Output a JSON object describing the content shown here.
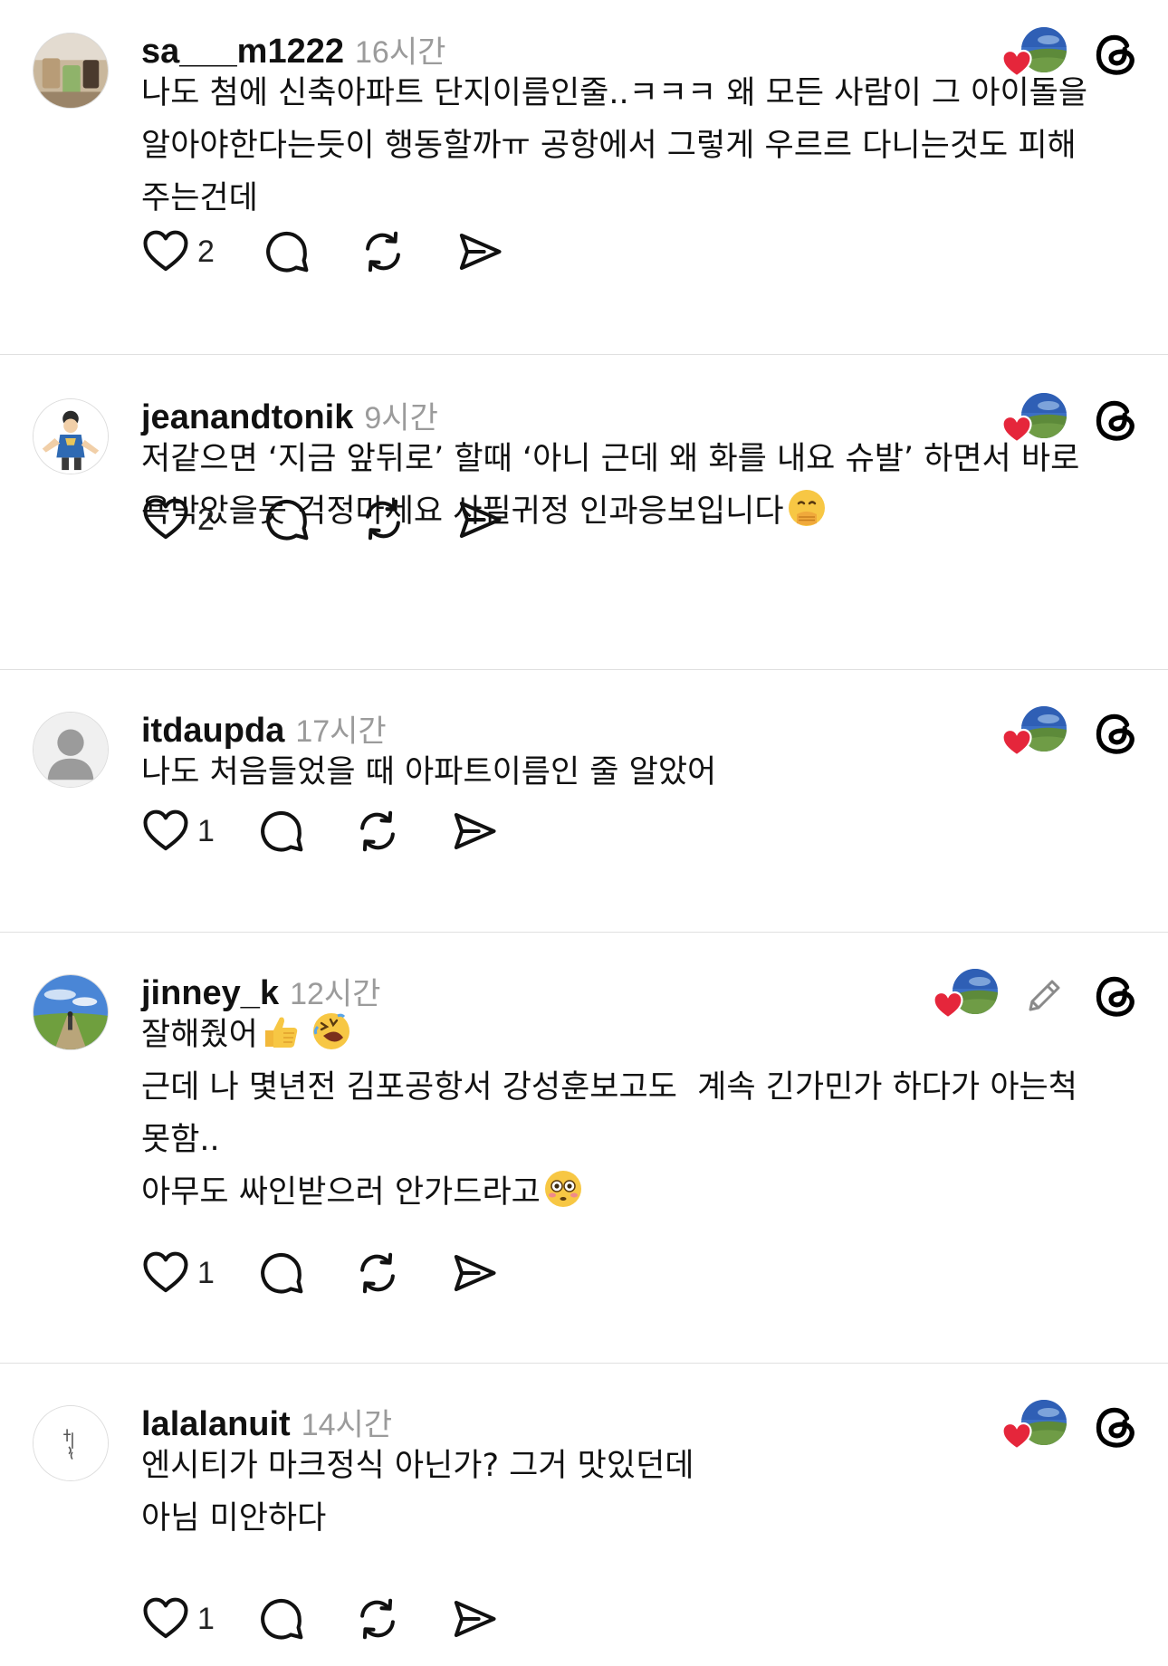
{
  "colors": {
    "like_heart": "#e5263b",
    "divider": "#e0e0e0",
    "timestamp": "#9b9b9b",
    "text": "#111111"
  },
  "posts": [
    {
      "username": "sa___m1222",
      "time": "16시간",
      "lines": [
        "나도 첨에 신축아파트 단지이름인줄..ㅋㅋㅋ 왜 모든 사람이 그 아이돌을",
        "알아야한다는듯이 행동할까ㅠ 공항에서 그렇게 우르르 다니는것도 피해",
        "주는건데"
      ],
      "likes": "2",
      "icons": [
        "heart-outline-icon",
        "reply-bubble-icon",
        "repost-icon",
        "share-send-icon",
        "threads-logo-icon"
      ]
    },
    {
      "username": "jeanandtonik",
      "time": "9시간",
      "lines": [
        "저같으면 ‘지금 앞뒤로’ 할때 ‘아니 근데 왜 화를 내요 슈발’ 하면서 바로",
        "욕박았을듯 걱정마세요 사필귀정 인과응보입니다"
      ],
      "emoji": "face-with-hand-over-mouth-emoji",
      "likes": "2"
    },
    {
      "username": "itdaupda",
      "time": "17시간",
      "lines": [
        "나도 처음들었을 때 아파트이름인 줄 알았어"
      ],
      "likes": "1"
    },
    {
      "username": "jinney_k",
      "time": "12시간",
      "lines": [
        "잘해줬어",
        "근데 나 몇년전 김포공항서 강성훈보고도  계속 긴가민가 하다가 아는척",
        "못함..",
        "아무도 싸인받으러 안가드라고"
      ],
      "emojis": [
        "thumbs-up-emoji",
        "rolling-laughing-emoji",
        "flushed-face-emoji"
      ],
      "likes": "1",
      "has_edit": true
    },
    {
      "username": "lalalanuit",
      "time": "14시간",
      "lines": [
        "엔시티가 마크정식 아닌가? 그거 맛있던데",
        "아님 미안하다"
      ],
      "likes": "1"
    }
  ]
}
